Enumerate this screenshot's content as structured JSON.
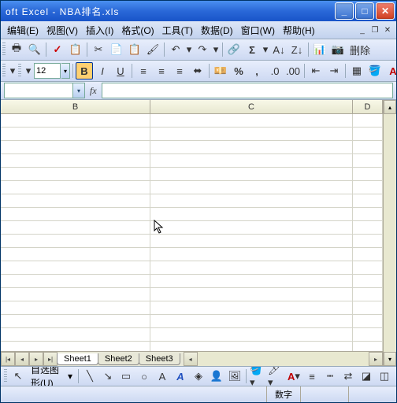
{
  "title": "oft Excel - NBA排名.xls",
  "menus": {
    "edit": "编辑(E)",
    "view": "视图(V)",
    "insert": "插入(I)",
    "format": "格式(O)",
    "tools": "工具(T)",
    "data": "数据(D)",
    "window": "窗口(W)",
    "help": "帮助(H)"
  },
  "toolbar2": {
    "fontsize": "12",
    "bold": "B",
    "italic": "I",
    "underline": "U",
    "delete": "删除"
  },
  "namebox": "",
  "columns": {
    "b": "B",
    "c": "C",
    "d": "D"
  },
  "tabs": {
    "s1": "Sheet1",
    "s2": "Sheet2",
    "s3": "Sheet3"
  },
  "draw": {
    "autoshape": "自选图形(U)"
  },
  "status": {
    "numlock": "数字"
  }
}
